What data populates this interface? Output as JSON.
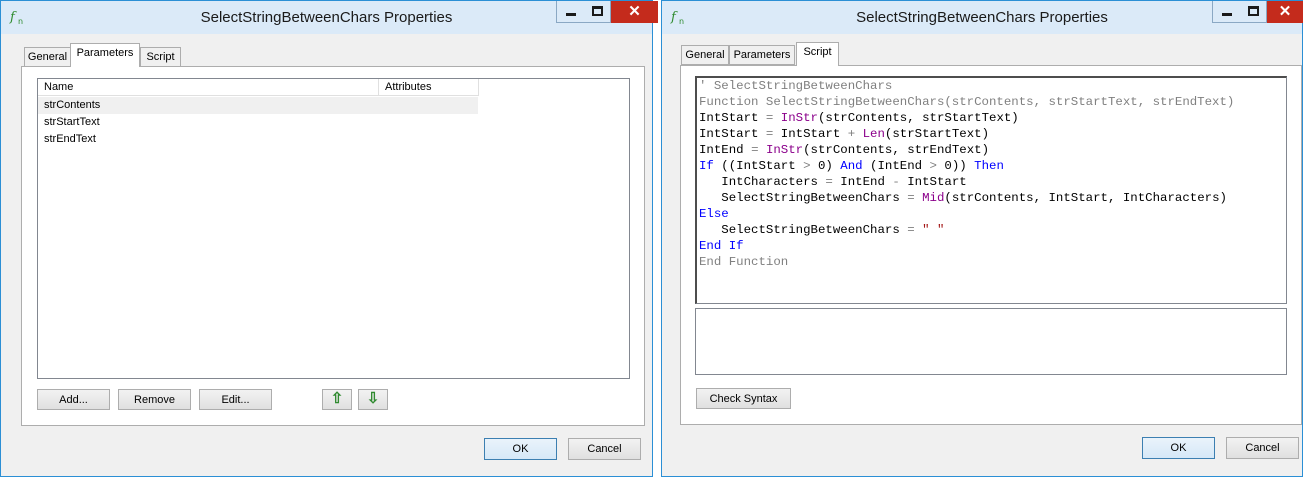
{
  "left_dialog": {
    "title": "SelectStringBetweenChars Properties",
    "tabs": [
      {
        "label": "General",
        "active": false
      },
      {
        "label": "Parameters",
        "active": true
      },
      {
        "label": "Script",
        "active": false
      }
    ],
    "columns": [
      "Name",
      "Attributes"
    ],
    "rows": [
      "strContents",
      "strStartText",
      "strEndText"
    ],
    "buttons": {
      "add": "Add...",
      "remove": "Remove",
      "edit": "Edit...",
      "ok": "OK",
      "cancel": "Cancel"
    },
    "icons": {
      "up": "arrow-up-icon",
      "down": "arrow-down-icon"
    }
  },
  "right_dialog": {
    "title": "SelectStringBetweenChars Properties",
    "tabs": [
      {
        "label": "General",
        "active": false
      },
      {
        "label": "Parameters",
        "active": false
      },
      {
        "label": "Script",
        "active": true
      }
    ],
    "script_lines": [
      [
        [
          "comment",
          "' SelectStringBetweenChars"
        ]
      ],
      [
        [
          "comment",
          "Function SelectStringBetweenChars(strContents, strStartText, strEndText)"
        ]
      ],
      [
        [
          "plain",
          "IntStart "
        ],
        [
          "op",
          "="
        ],
        [
          "plain",
          " "
        ],
        [
          "fn",
          "InStr"
        ],
        [
          "plain",
          "(strContents, strStartText)"
        ]
      ],
      [
        [
          "plain",
          "IntStart "
        ],
        [
          "op",
          "="
        ],
        [
          "plain",
          " IntStart "
        ],
        [
          "op",
          "+"
        ],
        [
          "plain",
          " "
        ],
        [
          "fn",
          "Len"
        ],
        [
          "plain",
          "(strStartText)"
        ]
      ],
      [
        [
          "plain",
          "IntEnd "
        ],
        [
          "op",
          "="
        ],
        [
          "plain",
          " "
        ],
        [
          "fn",
          "InStr"
        ],
        [
          "plain",
          "(strContents, strEndText)"
        ]
      ],
      [
        [
          "kw",
          "If"
        ],
        [
          "plain",
          " ((IntStart "
        ],
        [
          "op",
          ">"
        ],
        [
          "plain",
          " 0) "
        ],
        [
          "kw",
          "And"
        ],
        [
          "plain",
          " (IntEnd "
        ],
        [
          "op",
          ">"
        ],
        [
          "plain",
          " 0)) "
        ],
        [
          "kw",
          "Then"
        ]
      ],
      [
        [
          "plain",
          "   IntCharacters "
        ],
        [
          "op",
          "="
        ],
        [
          "plain",
          " IntEnd "
        ],
        [
          "op",
          "-"
        ],
        [
          "plain",
          " IntStart"
        ]
      ],
      [
        [
          "plain",
          "   SelectStringBetweenChars "
        ],
        [
          "op",
          "="
        ],
        [
          "plain",
          " "
        ],
        [
          "fn",
          "Mid"
        ],
        [
          "plain",
          "(strContents, IntStart, IntCharacters)"
        ]
      ],
      [
        [
          "kw",
          "Else"
        ]
      ],
      [
        [
          "plain",
          "   SelectStringBetweenChars "
        ],
        [
          "op",
          "="
        ],
        [
          "plain",
          " "
        ],
        [
          "str",
          "\" \""
        ]
      ],
      [
        [
          "kw",
          "End If"
        ]
      ],
      [
        [
          "comment",
          "End Function"
        ]
      ]
    ],
    "buttons": {
      "check_syntax": "Check Syntax",
      "ok": "OK",
      "cancel": "Cancel"
    }
  },
  "window_controls": {
    "minimize": "minimize-icon",
    "maximize": "maximize-icon",
    "close": "close-icon",
    "close_glyph": "✕"
  },
  "colors": {
    "titlebar": "#dbeaf8",
    "close": "#c42b1c",
    "comment": "#808080",
    "keyword": "#0000ff",
    "function": "#8b008b"
  }
}
